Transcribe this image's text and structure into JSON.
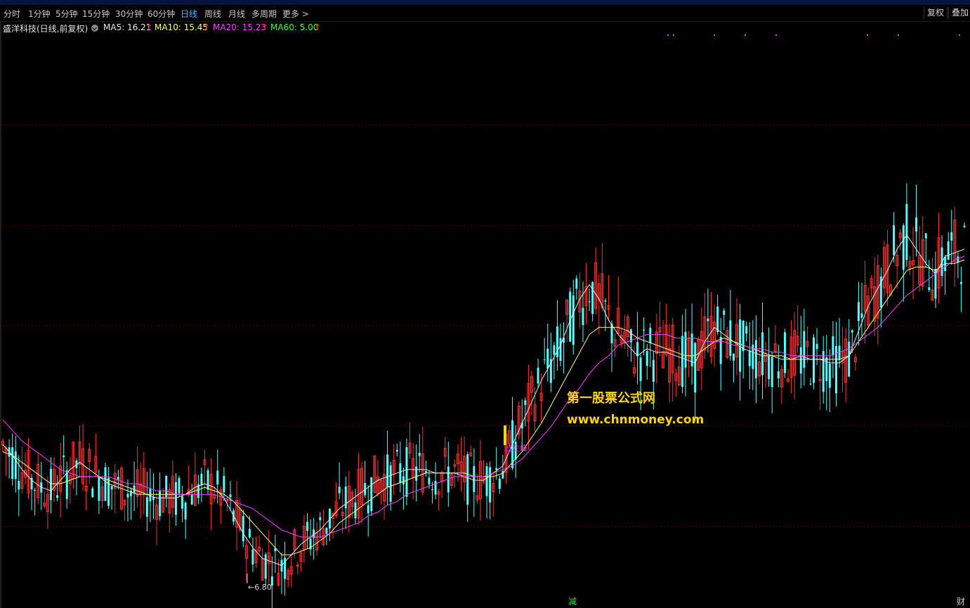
{
  "stock": {
    "title": "盛洋科技(日线,前复权)",
    "ma5": "MA5: 16.21",
    "ma10": "MA10: 15.45",
    "ma20": "MA20: 15.23",
    "ma60": "MA60: 5.00",
    "up_arrow": "↑"
  },
  "periods": [
    "分时",
    "1分钟",
    "5分钟",
    "15分钟",
    "30分钟",
    "60分钟",
    "日线",
    "周线",
    "月线",
    "多周期",
    "更多 >"
  ],
  "active_period": "日线",
  "buttons": {
    "fuquan": "复权",
    "diejia": "叠加"
  },
  "watermark": {
    "line1": "第一股票公式网",
    "line2": "www.chnmoney.com"
  },
  "annotations": {
    "low_label": "←6.80",
    "signal_label": "过左峰",
    "bottom_jian": "减",
    "bottom_cai": "财"
  },
  "colors": {
    "up": "#ff3232",
    "down": "#54ffff",
    "ma5": "#e8e8e8",
    "ma10": "#ffff80",
    "ma20": "#ff40ff",
    "ma60": "#40ff40",
    "grid": "#5a0000"
  },
  "chart_data": {
    "type": "candlestick",
    "ylim": [
      6.4,
      22.5
    ],
    "low_marker": 6.8,
    "series": [
      {
        "name": "MA5",
        "values": [
          10.7,
          10.4,
          10.0,
          9.7,
          9.5,
          9.4,
          9.7,
          10.0,
          10.2,
          10.0,
          9.8,
          9.6,
          9.5,
          9.4,
          9.3,
          9.3,
          9.2,
          9.2,
          9.2,
          9.3,
          9.5,
          9.6,
          9.5,
          9.2,
          8.7,
          8.2,
          7.8,
          7.5,
          7.4,
          7.3,
          7.6,
          7.9,
          8.1,
          8.3,
          8.6,
          8.9,
          9.1,
          9.3,
          9.5,
          9.7,
          9.8,
          9.9,
          10.0,
          10.0,
          10.0,
          9.9,
          9.9,
          9.9,
          9.8,
          9.7,
          9.7,
          9.9,
          10.1,
          10.7,
          11.3,
          11.9,
          12.5,
          13.0,
          13.5,
          14.2,
          14.8,
          15.2,
          14.8,
          14.2,
          13.8,
          13.5,
          13.2,
          13.4,
          13.3,
          13.3,
          13.2,
          13.1,
          13.0,
          13.6,
          14.0,
          13.8,
          13.6,
          13.4,
          13.3,
          13.2,
          13.2,
          13.1,
          13.1,
          13.2,
          13.1,
          13.1,
          13.0,
          13.0,
          13.2,
          13.9,
          14.6,
          15.1,
          15.6,
          16.2,
          16.6,
          16.2,
          15.8,
          15.5,
          16.0,
          16.1,
          16.2
        ]
      },
      {
        "name": "MA10",
        "values": [
          10.5,
          10.4,
          10.2,
          10.0,
          9.8,
          9.6,
          9.6,
          9.7,
          9.8,
          9.8,
          9.8,
          9.7,
          9.6,
          9.5,
          9.4,
          9.3,
          9.3,
          9.3,
          9.3,
          9.3,
          9.4,
          9.5,
          9.4,
          9.3,
          9.1,
          8.8,
          8.5,
          8.2,
          7.9,
          7.6,
          7.6,
          7.7,
          7.8,
          8.0,
          8.2,
          8.5,
          8.7,
          8.9,
          9.1,
          9.3,
          9.5,
          9.6,
          9.7,
          9.8,
          9.9,
          9.9,
          9.9,
          9.9,
          9.9,
          9.8,
          9.8,
          9.8,
          9.9,
          10.2,
          10.5,
          10.9,
          11.3,
          11.8,
          12.3,
          12.8,
          13.3,
          13.8,
          14.0,
          14.0,
          14.0,
          13.9,
          13.7,
          13.6,
          13.5,
          13.4,
          13.3,
          13.2,
          13.2,
          13.4,
          13.6,
          13.7,
          13.6,
          13.5,
          13.4,
          13.3,
          13.2,
          13.2,
          13.1,
          13.1,
          13.1,
          13.1,
          13.1,
          13.1,
          13.2,
          13.6,
          14.0,
          14.4,
          14.8,
          15.2,
          15.6,
          15.7,
          15.7,
          15.6,
          15.8,
          15.8,
          15.9
        ]
      },
      {
        "name": "MA20",
        "values": [
          11.4,
          11.1,
          10.8,
          10.6,
          10.4,
          10.2,
          10.0,
          9.9,
          9.8,
          9.8,
          9.8,
          9.8,
          9.7,
          9.6,
          9.6,
          9.5,
          9.4,
          9.4,
          9.3,
          9.3,
          9.3,
          9.3,
          9.3,
          9.2,
          9.1,
          9.0,
          8.9,
          8.7,
          8.5,
          8.3,
          8.2,
          8.1,
          8.1,
          8.1,
          8.2,
          8.3,
          8.4,
          8.5,
          8.7,
          8.8,
          9.0,
          9.1,
          9.3,
          9.4,
          9.5,
          9.6,
          9.7,
          9.8,
          9.8,
          9.8,
          9.8,
          9.9,
          10.0,
          10.1,
          10.3,
          10.6,
          10.9,
          11.2,
          11.6,
          12.0,
          12.3,
          12.7,
          13.0,
          13.2,
          13.5,
          13.6,
          13.7,
          13.8,
          13.8,
          13.8,
          13.7,
          13.7,
          13.7,
          13.6,
          13.6,
          13.6,
          13.5,
          13.5,
          13.4,
          13.4,
          13.3,
          13.3,
          13.2,
          13.2,
          13.2,
          13.2,
          13.2,
          13.3,
          13.4,
          13.6,
          13.8,
          14.0,
          14.3,
          14.6,
          14.9,
          15.1,
          15.3,
          15.5,
          15.7,
          15.9,
          16.0
        ]
      }
    ]
  }
}
